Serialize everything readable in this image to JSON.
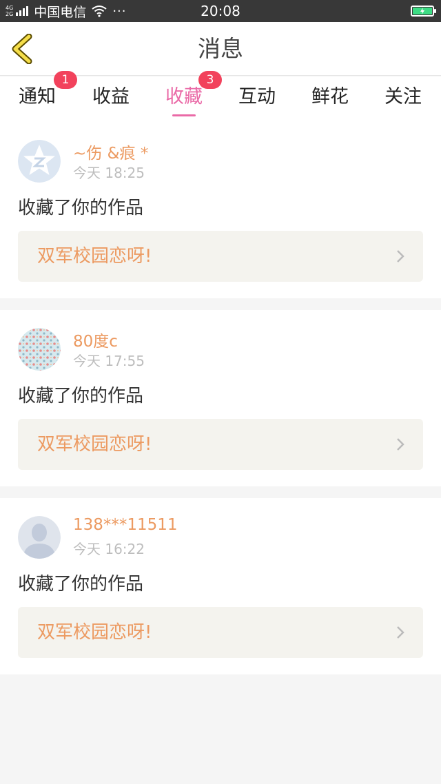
{
  "status_bar": {
    "network_top": "4G",
    "network_bottom": "2G",
    "carrier": "中国电信",
    "more": "···",
    "time": "20:08",
    "icons": [
      "signal-icon",
      "wifi-icon",
      "battery-charging-icon"
    ]
  },
  "header": {
    "title": "消息",
    "back_icon": "chevron-left-icon"
  },
  "tabs": [
    {
      "label": "通知",
      "badge": "1"
    },
    {
      "label": "收益",
      "badge": ""
    },
    {
      "label": "收藏",
      "badge": "3",
      "active": true
    },
    {
      "label": "互动",
      "badge": ""
    },
    {
      "label": "鲜花",
      "badge": ""
    },
    {
      "label": "关注",
      "badge": ""
    }
  ],
  "colors": {
    "accent": "#ea6aa7",
    "badge": "#f2425c",
    "username": "#ec9a61",
    "work_bg": "#f4f3ee"
  },
  "feed": [
    {
      "user": "~伤 &痕 *",
      "time": "今天 18:25",
      "action": "收藏了你的作品",
      "work": "双军校园恋呀!",
      "avatar_icon": "qzone-star-avatar-icon"
    },
    {
      "user": "80度c",
      "time": "今天 17:55",
      "action": "收藏了你的作品",
      "work": "双军校园恋呀!",
      "avatar_icon": "pattern-avatar-icon"
    },
    {
      "user": "138***11511",
      "time": "今天 16:22",
      "action": "收藏了你的作品",
      "work": "双军校园恋呀!",
      "avatar_icon": "default-person-avatar-icon"
    }
  ]
}
